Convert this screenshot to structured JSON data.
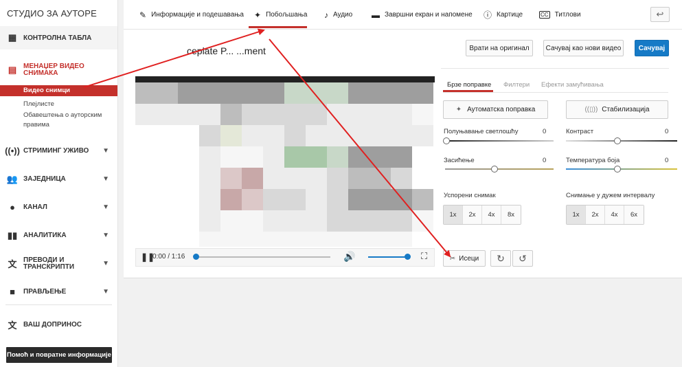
{
  "sidebar": {
    "title": "СТУДИО ЗА АУТОРЕ",
    "dashboard": "КОНТРОЛНА ТАБЛА",
    "video_manager": "МЕНАЏЕР ВИДЕО СНИМАКА",
    "sub_items": [
      "Видео снимци",
      "Плејлисте",
      "Обавештења о ауторским правима"
    ],
    "live": "СТРИМИНГ УЖИВО",
    "community": "ЗАЈЕДНИЦА",
    "channel": "КАНАЛ",
    "analytics": "АНАЛИТИКА",
    "translations": "ПРЕВОДИ И ТРАНСКРИПТИ",
    "create": "ПРАВЉЕЊЕ",
    "contribution": "ВАШ ДОПРИНОС",
    "help": "Помоћ и повратне информације"
  },
  "tabs": {
    "info": "Информације и подешавања",
    "enhance": "Побољшања",
    "audio": "Аудио",
    "endscreen": "Завршни екран и напомене",
    "cards": "Картице",
    "subtitles": "Титлови"
  },
  "editor": {
    "video_title": "ceplate P... ...ment",
    "revert": "Врати на оригинал",
    "save_new": "Сачувај као нови видео",
    "save": "Сачувај"
  },
  "player": {
    "time": "0:00 / 1:16",
    "progress": 0.0,
    "volume": 1.0
  },
  "panel": {
    "subtabs": [
      "Брзе поправке",
      "Филтери",
      "Ефекти замућивања"
    ],
    "auto_fix": "Аутоматска поправка",
    "stabilize": "Стабилизација",
    "sliders": [
      {
        "label": "Полуњавање светлошћу",
        "value": "0"
      },
      {
        "label": "Контраст",
        "value": "0"
      },
      {
        "label": "Засићење",
        "value": "0"
      },
      {
        "label": "Температура боја",
        "value": "0"
      }
    ],
    "slowmo_label": "Успорени снимак",
    "slowmo_options": [
      "1x",
      "2x",
      "4x",
      "8x"
    ],
    "timelapse_label": "Снимање у дужем интервалу",
    "timelapse_options": [
      "1x",
      "2x",
      "4x",
      "6x"
    ],
    "trim": "Исеци"
  },
  "colors": {
    "accent": "#c4302b",
    "primary": "#167ac6",
    "annotation": "#e02020"
  }
}
